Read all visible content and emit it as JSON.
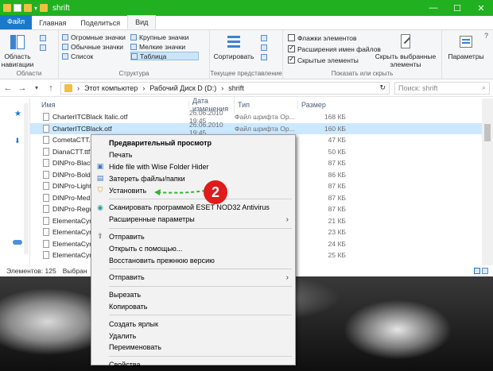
{
  "window": {
    "title": "shrift",
    "minimize": "—",
    "maximize": "☐",
    "close": "✕"
  },
  "tabs": [
    "Файл",
    "Главная",
    "Поделиться",
    "Вид"
  ],
  "ribbon": {
    "nav_area_label": "Область навигации",
    "nav_group": "Области",
    "layout": {
      "huge_icons": "Огромные значки",
      "large_icons": "Крупные значки",
      "normal_icons": "Обычные значки",
      "small_icons": "Мелкие значки",
      "list": "Список",
      "table": "Таблица",
      "group": "Структура"
    },
    "sort_label": "Сортировать",
    "current_view_group": "Текущее представление",
    "flags": "Флажки элементов",
    "extensions": "Расширения имен файлов",
    "hidden": "Скрытые элементы",
    "hide_selected": "Скрыть выбранные элементы",
    "show_hide_group": "Показать или скрыть",
    "params": "Параметры"
  },
  "address": {
    "path": [
      "Этот компьютер",
      "Рабочий Диск D (D:)",
      "shrift"
    ],
    "search_placeholder": "Поиск: shrift"
  },
  "columns": [
    "Имя",
    "Дата изменения",
    "Тип",
    "Размер"
  ],
  "files": [
    {
      "name": "CharterITCBlack Italic.otf",
      "date": "26.06.2010 19:45",
      "type": "Файл шрифта Op...",
      "size": "168 КБ"
    },
    {
      "name": "CharterITCBlack.otf",
      "date": "26.06.2010 19:45",
      "type": "Файл шрифта Op...",
      "size": "160 КБ"
    },
    {
      "name": "CometaCTT.",
      "date": "",
      "type": "",
      "size": "47 КБ"
    },
    {
      "name": "DianaCTT.ttf",
      "date": "",
      "type": "",
      "size": "50 КБ"
    },
    {
      "name": "DINPro-Black",
      "date": "",
      "type": "",
      "size": "87 КБ"
    },
    {
      "name": "DINPro-Bold",
      "date": "",
      "type": "",
      "size": "86 КБ"
    },
    {
      "name": "DINPro-Light",
      "date": "",
      "type": "",
      "size": "87 КБ"
    },
    {
      "name": "DINPro-Med",
      "date": "",
      "type": "",
      "size": "87 КБ"
    },
    {
      "name": "DINPro-Regu",
      "date": "",
      "type": "",
      "size": "87 КБ"
    },
    {
      "name": "ElementaCyr",
      "date": "",
      "type": "",
      "size": "21 КБ"
    },
    {
      "name": "ElementaCyr",
      "date": "",
      "type": "",
      "size": "23 КБ"
    },
    {
      "name": "ElementaCyr",
      "date": "",
      "type": "",
      "size": "24 КБ"
    },
    {
      "name": "ElementaCyr",
      "date": "",
      "type": "",
      "size": "25 КБ"
    }
  ],
  "status": {
    "count": "Элементов: 125",
    "selected": "Выбран"
  },
  "context_menu": [
    {
      "label": "Предварительный просмотр",
      "bold": true
    },
    {
      "label": "Печать"
    },
    {
      "label": "Hide file with Wise Folder Hider",
      "icon": "wise-icon"
    },
    {
      "label": "Затереть файлы/папки",
      "icon": "shred-icon"
    },
    {
      "label": "Установить",
      "icon": "shield-icon"
    },
    {
      "sep": true
    },
    {
      "label": "Сканировать программой ESET NOD32 Antivirus",
      "icon": "eset-icon"
    },
    {
      "label": "Расширенные параметры",
      "submenu": true
    },
    {
      "sep": true
    },
    {
      "label": "Отправить",
      "icon": "share-icon"
    },
    {
      "label": "Открыть с помощью..."
    },
    {
      "label": "Восстановить прежнюю версию"
    },
    {
      "sep": true
    },
    {
      "label": "Отправить",
      "submenu": true
    },
    {
      "sep": true
    },
    {
      "label": "Вырезать"
    },
    {
      "label": "Копировать"
    },
    {
      "sep": true
    },
    {
      "label": "Создать ярлык"
    },
    {
      "label": "Удалить"
    },
    {
      "label": "Переименовать"
    },
    {
      "sep": true
    },
    {
      "label": "Свойства"
    }
  ],
  "annotation": "2",
  "colors": {
    "titlebar": "#20b020",
    "file_tab": "#1979ca",
    "annotation": "#e01b1b",
    "arrow": "#2fb52f"
  }
}
